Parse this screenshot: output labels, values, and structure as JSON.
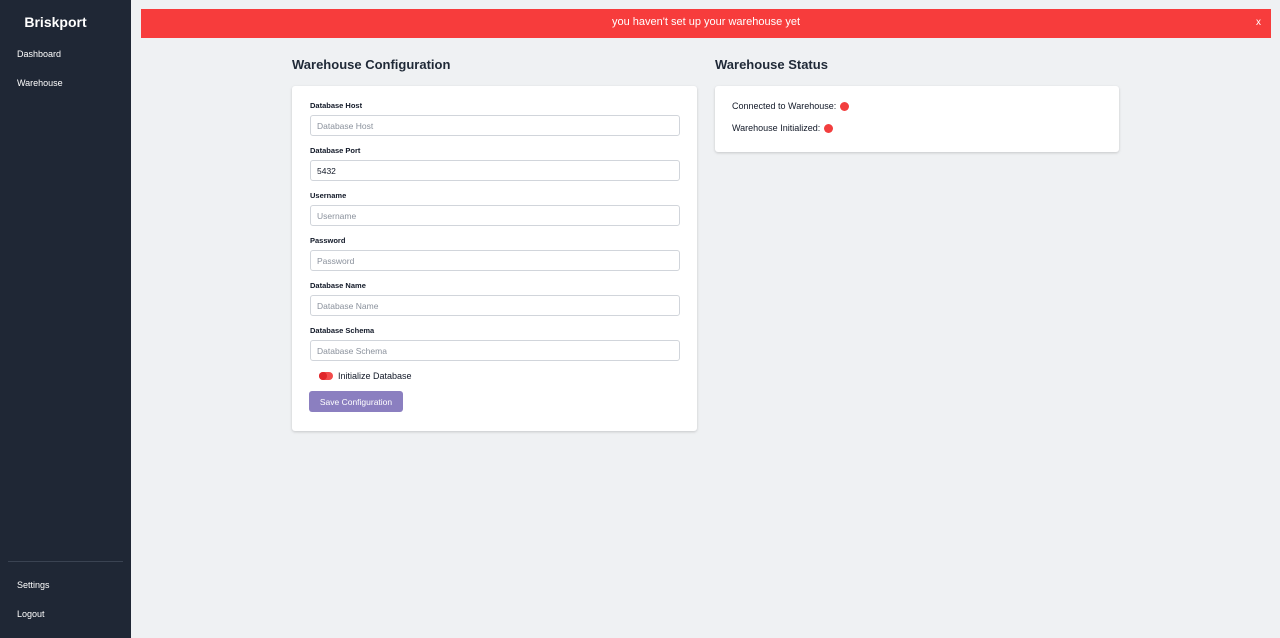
{
  "app": {
    "brand": "Briskport"
  },
  "sidebar": {
    "items": [
      {
        "label": "Dashboard"
      },
      {
        "label": "Warehouse"
      }
    ],
    "bottom_items": [
      {
        "label": "Settings"
      },
      {
        "label": "Logout"
      }
    ]
  },
  "banner": {
    "message": "you haven't set up your warehouse yet",
    "close_label": "x",
    "color": "#f73c3c"
  },
  "config": {
    "title": "Warehouse Configuration",
    "fields": [
      {
        "label": "Database Host",
        "value": "",
        "placeholder": "Database Host"
      },
      {
        "label": "Database Port",
        "value": "5432",
        "placeholder": "Database Port"
      },
      {
        "label": "Username",
        "value": "",
        "placeholder": "Username"
      },
      {
        "label": "Password",
        "value": "",
        "placeholder": "Password"
      },
      {
        "label": "Database Name",
        "value": "",
        "placeholder": "Database Name"
      },
      {
        "label": "Database Schema",
        "value": "",
        "placeholder": "Database Schema"
      }
    ],
    "initialize_label": "Initialize Database",
    "initialize_enabled": false,
    "save_label": "Save Configuration",
    "save_color": "#8b7fc0"
  },
  "status": {
    "title": "Warehouse Status",
    "rows": [
      {
        "label": "Connected to Warehouse:",
        "state": "error",
        "color": "#f23e3e"
      },
      {
        "label": "Warehouse Initialized:",
        "state": "error",
        "color": "#f23e3e"
      }
    ]
  }
}
